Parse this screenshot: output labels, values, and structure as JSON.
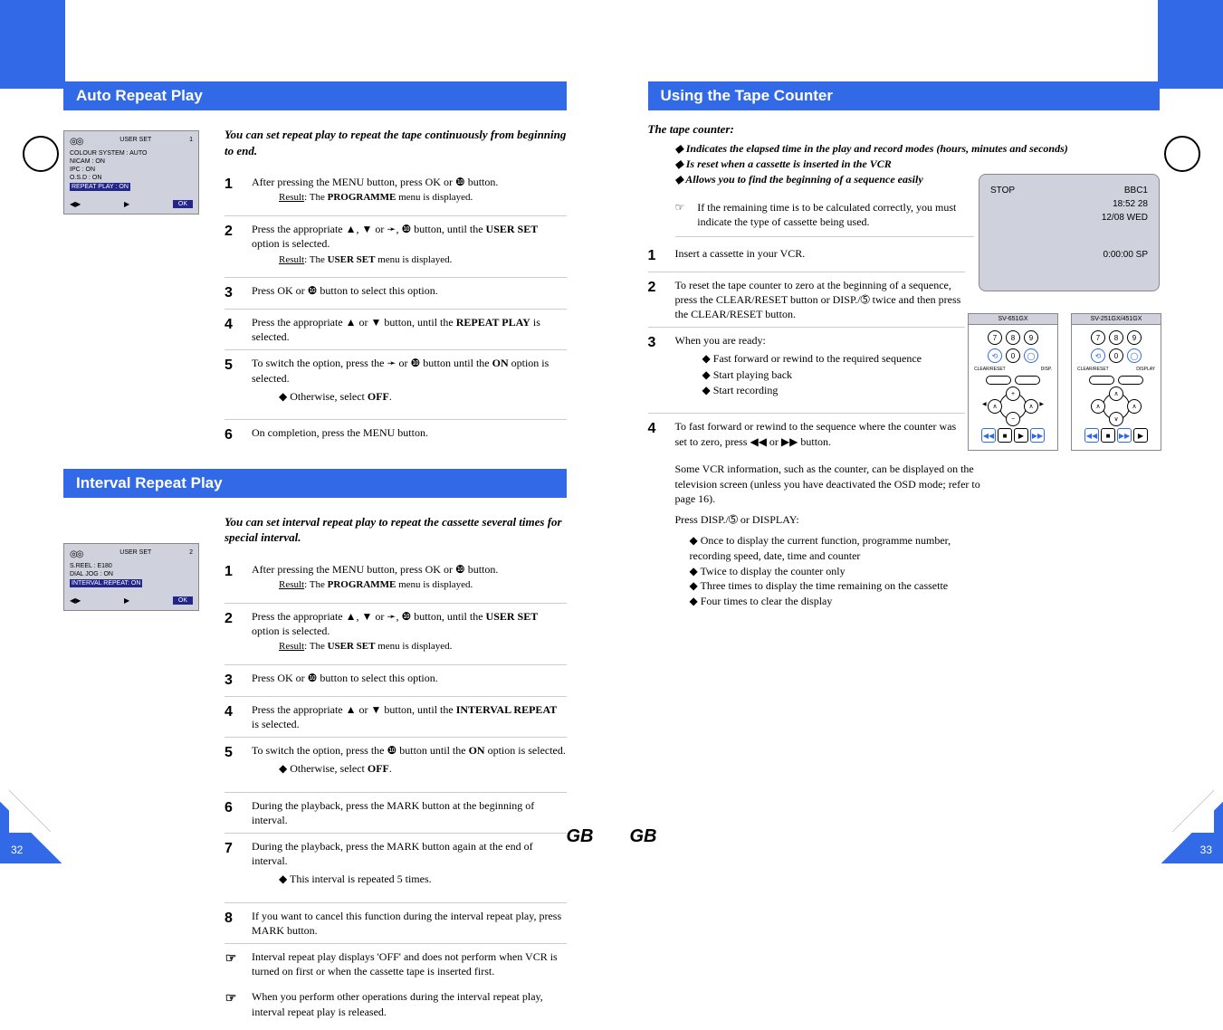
{
  "page_left": {
    "number": "32",
    "region": "GB",
    "section_a": {
      "title": "Auto Repeat Play",
      "intro": "You can set repeat play to repeat the tape continuously from beginning to end.",
      "steps": [
        {
          "n": "1",
          "t": "After pressing the MENU button, press OK or ❿ button.",
          "r": "<u>Result</u>: The <b>PROGRAMME</b> menu is displayed."
        },
        {
          "n": "2",
          "t": "Press the appropriate ▲, ▼ or ➛, ❿ button, until the <b>USER SET</b> option is selected.",
          "r": "<u>Result</u>: The <b>USER SET</b> menu is displayed."
        },
        {
          "n": "3",
          "t": "Press OK or ❿ button to select this option."
        },
        {
          "n": "4",
          "t": "Press the appropriate ▲ or ▼ button, until the <b>REPEAT PLAY</b> is selected."
        },
        {
          "n": "5",
          "t": "To switch the option, press the ➛ or ❿ button until the <b>ON</b> option is selected.",
          "sub": [
            "Otherwise, select <b>OFF</b>."
          ]
        },
        {
          "n": "6",
          "t": "On completion, press the MENU button."
        }
      ],
      "screen": {
        "topL": "USER SET",
        "topR": "1",
        "items": [
          "COLOUR SYSTEM : AUTO",
          "NICAM          : ON",
          "IPC            : ON",
          "O.S.D          : ON"
        ],
        "sel": "REPEAT PLAY   : ON",
        "btnL": "◀▶",
        "btnM": "▶",
        "btnR": "OK"
      }
    },
    "section_b": {
      "title": "Interval Repeat Play",
      "intro": "You can set interval repeat play to repeat the cassette several times for special interval.",
      "steps": [
        {
          "n": "1",
          "t": "After pressing the MENU button, press OK or ❿ button.",
          "r": "<u>Result</u>: The <b>PROGRAMME</b> menu is displayed."
        },
        {
          "n": "2",
          "t": "Press the appropriate ▲, ▼ or ➛, ❿ button, until the <b>USER SET</b> option is selected.",
          "r": "<u>Result</u>: The <b>USER SET</b> menu is displayed."
        },
        {
          "n": "3",
          "t": "Press OK or ❿ button to select this option."
        },
        {
          "n": "4",
          "t": "Press the appropriate ▲ or ▼ button, until the <b>INTERVAL REPEAT</b> is selected."
        },
        {
          "n": "5",
          "t": "To switch the option, press the ❿ button until the <b>ON</b> option is selected.",
          "sub": [
            "Otherwise, select <b>OFF</b>."
          ]
        },
        {
          "n": "6",
          "t": "During the playback, press the MARK button at the beginning of interval."
        },
        {
          "n": "7",
          "t": "During the playback, press the MARK button again at the end of interval.",
          "sub": [
            "This interval is repeated 5 times."
          ]
        },
        {
          "n": "8",
          "t": "If you want to cancel this function during the interval repeat play, press MARK button."
        }
      ],
      "notes": [
        {
          "hand": true,
          "t": "Interval repeat play displays 'OFF' and does not perform when VCR is turned on first or when the cassette tape is inserted first."
        },
        {
          "hand": true,
          "t": "When you perform other operations during the interval repeat play, interval repeat play is released."
        }
      ],
      "screen": {
        "topL": "USER SET",
        "topR": "2",
        "items": [
          "S.REEL        : E180",
          "DIAL JOG      : ON"
        ],
        "sel": "INTERVAL REPEAT: ON",
        "btnL": "◀▶",
        "btnM": "▶",
        "btnR": "OK"
      }
    }
  },
  "page_right": {
    "number": "33",
    "region": "GB",
    "title": "Using the Tape Counter",
    "intro": "The tape counter:",
    "intro_sub": [
      "Indicates the elapsed time in the play and record modes (hours, minutes and seconds)",
      "Is reset when a cassette is inserted in the VCR",
      "Allows you to find the beginning of a sequence easily"
    ],
    "note": "If the remaining time is to be calculated correctly, you must indicate the type of cassette being used.",
    "steps": [
      {
        "n": "1",
        "t": "Insert a cassette in your VCR."
      },
      {
        "n": "2",
        "t": "To reset the tape counter to zero at the beginning of a sequence, press the CLEAR/RESET button or DISP./➄ twice and then press the CLEAR/RESET button."
      },
      {
        "n": "3",
        "t": "When you are ready:",
        "sub": [
          "Fast forward or rewind to the required sequence",
          "Start playing back",
          "Start recording"
        ]
      },
      {
        "n": "4",
        "t": "To fast forward or rewind to the sequence where the counter was set to zero, press ◀◀ or ▶▶ button."
      }
    ],
    "tail_para1": "Some VCR information, such as the counter, can be displayed on the television screen (unless you have deactivated the OSD mode; refer to page 16).",
    "tail_para2": "Press DISP./➄ or DISPLAY:",
    "tail_list": [
      "Once to display the current function, programme number, recording speed, date, time and counter",
      "Twice to display the counter only",
      "Three times to display the time remaining on the cassette",
      "Four times to clear the display"
    ],
    "big_screen": {
      "a": "STOP",
      "b": "BBC1",
      "c": "18:52  28",
      "d": "12/08  WED",
      "e": "0:00:00   SP"
    },
    "remotes": [
      {
        "cap": "SV-651GX",
        "clear": "CLEAR/RESET",
        "disp": "DISP."
      },
      {
        "cap": "SV-251GX/451GX",
        "clear": "CLEAR/RESET",
        "disp": "DISPLAY"
      }
    ]
  }
}
